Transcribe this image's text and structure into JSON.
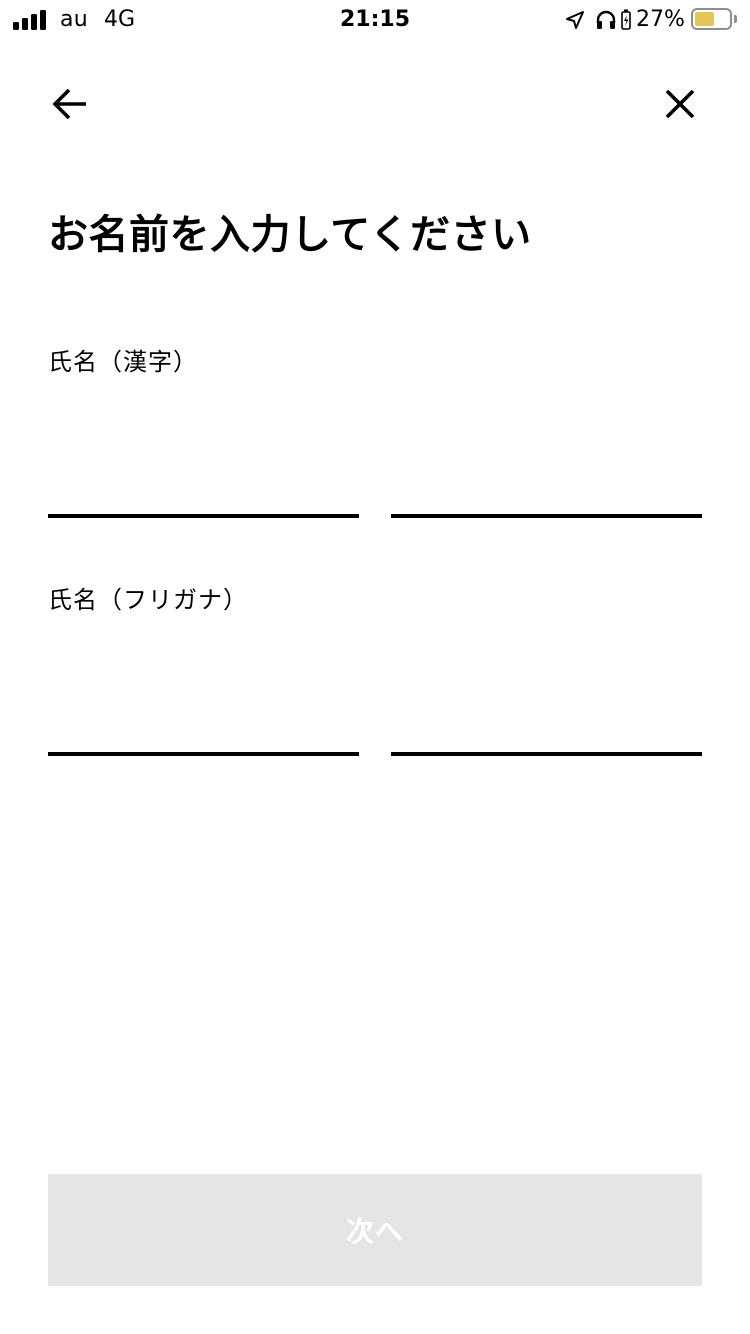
{
  "status_bar": {
    "carrier": "au",
    "network": "4G",
    "time": "21:15",
    "battery_percent": "27%",
    "battery_level": 0.27,
    "battery_color": "#e2c65a",
    "signal_bars": 4,
    "icons": [
      "signal-strength-icon",
      "location-arrow-icon",
      "headphones-icon",
      "charging-icon",
      "battery-icon"
    ]
  },
  "nav": {
    "back_icon": "arrow-left-icon",
    "close_icon": "close-icon"
  },
  "page": {
    "title": "お名前を入力してください"
  },
  "form": {
    "kanji": {
      "label": "氏名（漢字）",
      "last_name": {
        "value": "",
        "placeholder": ""
      },
      "first_name": {
        "value": "",
        "placeholder": ""
      }
    },
    "kana": {
      "label": "氏名（フリガナ）",
      "last_name": {
        "value": "",
        "placeholder": ""
      },
      "first_name": {
        "value": "",
        "placeholder": ""
      }
    }
  },
  "next_button": {
    "label": "次へ",
    "disabled": true,
    "background_color": "#e5e5e5",
    "text_color": "#ffffff"
  }
}
